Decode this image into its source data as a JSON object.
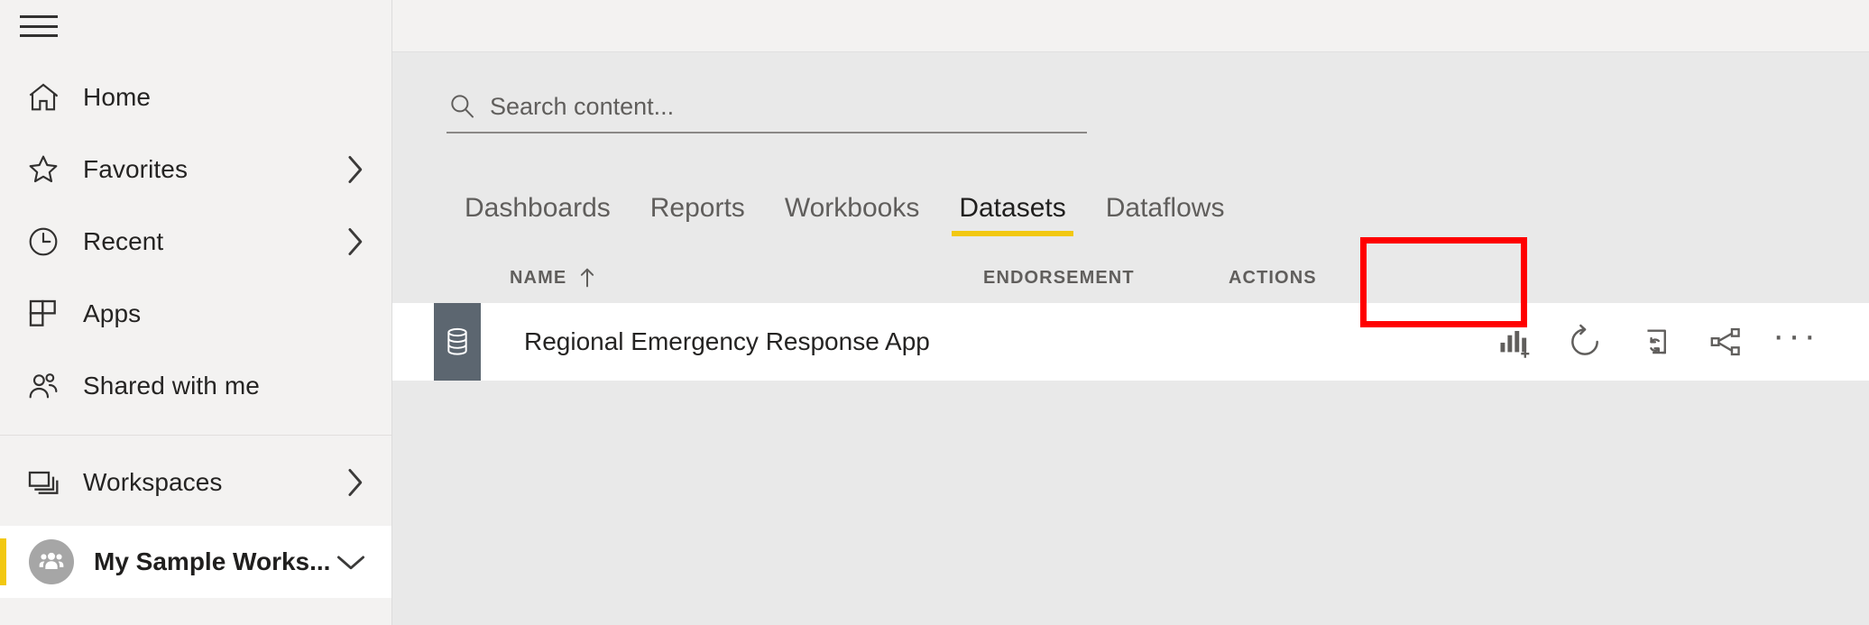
{
  "sidebar": {
    "menu_button": "hamburger-menu",
    "items": [
      {
        "label": "Home",
        "icon": "home-icon",
        "has_chevron": false
      },
      {
        "label": "Favorites",
        "icon": "star-icon",
        "has_chevron": true
      },
      {
        "label": "Recent",
        "icon": "clock-icon",
        "has_chevron": true
      },
      {
        "label": "Apps",
        "icon": "apps-grid-icon",
        "has_chevron": false
      },
      {
        "label": "Shared with me",
        "icon": "people-icon",
        "has_chevron": false
      }
    ],
    "lower_items": [
      {
        "label": "Workspaces",
        "icon": "workspaces-stack-icon",
        "has_chevron": true
      }
    ],
    "selected_workspace": {
      "label": "My Sample Works...",
      "avatar_icon": "group-avatar-icon",
      "chevron": "chevron-down-icon",
      "accent_color": "#f2c811"
    }
  },
  "search": {
    "placeholder": "Search content...",
    "value": "",
    "icon": "search-icon"
  },
  "tabs": [
    {
      "label": "Dashboards",
      "active": false
    },
    {
      "label": "Reports",
      "active": false
    },
    {
      "label": "Workbooks",
      "active": false
    },
    {
      "label": "Datasets",
      "active": true
    },
    {
      "label": "Dataflows",
      "active": false
    }
  ],
  "table": {
    "columns": [
      {
        "label": "NAME",
        "sorted": true,
        "sort_direction": "ascending",
        "sort_icon": "arrow-up-icon"
      },
      {
        "label": "ENDORSEMENT",
        "sorted": false
      },
      {
        "label": "ACTIONS",
        "sorted": false
      }
    ],
    "rows": [
      {
        "name": "Regional Emergency Response App",
        "type_icon": "dataset-database-icon",
        "endorsement": "",
        "actions": [
          {
            "name": "create-report-icon",
            "title": "Create report"
          },
          {
            "name": "refresh-now-icon",
            "title": "Refresh now"
          },
          {
            "name": "schedule-refresh-icon",
            "title": "Schedule refresh"
          },
          {
            "name": "share-icon",
            "title": "Share"
          },
          {
            "name": "more-options-icon",
            "title": "More options",
            "glyph": "···"
          }
        ]
      }
    ]
  },
  "annotations": [
    {
      "name": "datasets-tab-highlight",
      "color": "#ff0000",
      "target": "Datasets tab"
    },
    {
      "name": "schedule-refresh-highlight",
      "color": "#ff0000",
      "target": "Schedule refresh action icon"
    }
  ],
  "theme": {
    "sidebar_bg": "#f3f2f1",
    "content_bg": "#e9e9e9",
    "row_bg": "#ffffff",
    "accent_yellow": "#f2c811",
    "dataset_tile": "#5c6670",
    "icon_gray": "#605e5c",
    "annotation_red": "#ff0000"
  }
}
